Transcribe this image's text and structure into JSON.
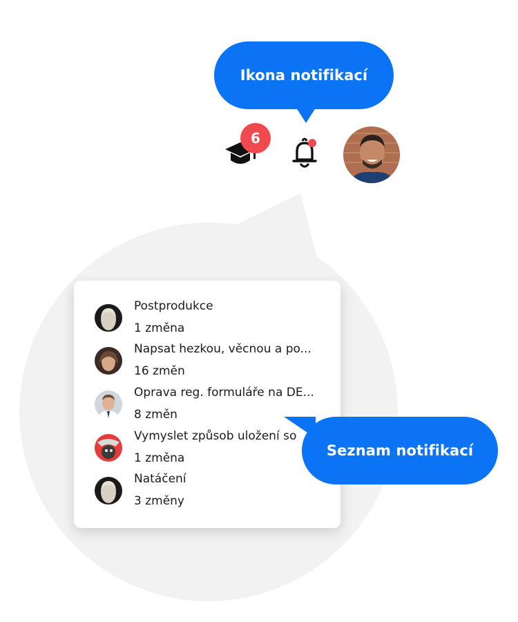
{
  "callouts": {
    "icon": "Ikona notifikací",
    "list": "Seznam notifikací"
  },
  "header": {
    "course_icon": "graduation-cap-icon",
    "course_badge_count": "6",
    "bell_icon": "bell-icon",
    "bell_has_unread": true,
    "avatar": "user-avatar"
  },
  "notifications": [
    {
      "title": "Postprodukce",
      "count": "1 změna"
    },
    {
      "title": "Napsat hezkou, věcnou a po...",
      "count": "16 změn"
    },
    {
      "title": "Oprava reg. formuláře na DE...",
      "count": "8 změn"
    },
    {
      "title": "Vymyslet způsob uložení so",
      "count": "1 změna"
    },
    {
      "title": "Natáčení",
      "count": "3 změny"
    }
  ],
  "colors": {
    "accent": "#0a74f5",
    "badge": "#f0494f",
    "backdrop": "#f2f2f2"
  }
}
